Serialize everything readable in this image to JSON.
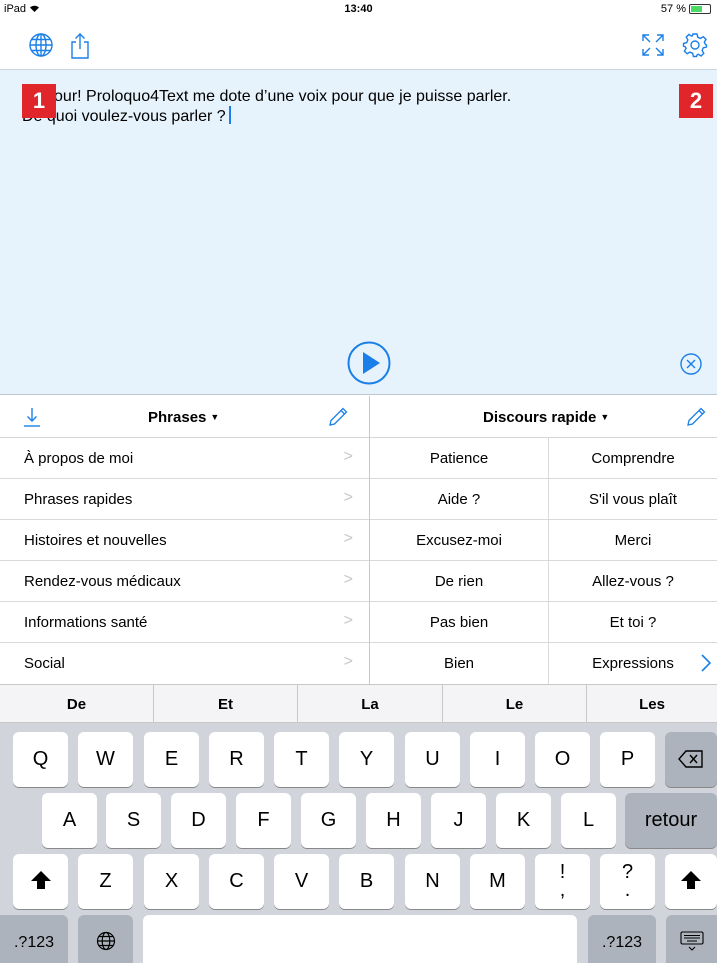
{
  "status_bar": {
    "device": "iPad",
    "time": "13:40",
    "battery": "57 %",
    "battery_level": 0.57
  },
  "toolbar": {
    "globe_icon": "globe-icon",
    "share_icon": "share-icon",
    "expand_icon": "expand-icon",
    "settings_icon": "gear-icon"
  },
  "badges": {
    "one": "1",
    "two": "2"
  },
  "editor": {
    "line1": "Bonjour! Proloquo4Text me dote d’une voix pour que je puisse parler.",
    "line2": "De quoi voulez-vous parler ?"
  },
  "phrases_panel": {
    "title": "Phrases",
    "items": [
      "À propos de moi",
      "Phrases rapides",
      "Histoires et nouvelles",
      "Rendez-vous médicaux",
      "Informations santé",
      "Social"
    ]
  },
  "quick_panel": {
    "title": "Discours rapide",
    "cells": [
      [
        "Patience",
        "Comprendre"
      ],
      [
        "Aide ?",
        "S'il vous plaît"
      ],
      [
        "Excusez-moi",
        "Merci"
      ],
      [
        "De rien",
        "Allez-vous ?"
      ],
      [
        "Pas bien",
        "Et toi ?"
      ],
      [
        "Bien",
        "Expressions"
      ]
    ]
  },
  "suggestions": [
    "De",
    "Et",
    "La",
    "Le",
    "Les"
  ],
  "keyboard": {
    "row1": [
      "Q",
      "W",
      "E",
      "R",
      "T",
      "Y",
      "U",
      "I",
      "O",
      "P"
    ],
    "row2": [
      "A",
      "S",
      "D",
      "F",
      "G",
      "H",
      "J",
      "K",
      "L"
    ],
    "row3": [
      "Z",
      "X",
      "C",
      "V",
      "B",
      "N",
      "M"
    ],
    "return_label": "retour",
    "numbers_label": ".?123",
    "punct1_top": "!",
    "punct1_bottom": ",",
    "punct2_top": "?",
    "punct2_bottom": "."
  }
}
